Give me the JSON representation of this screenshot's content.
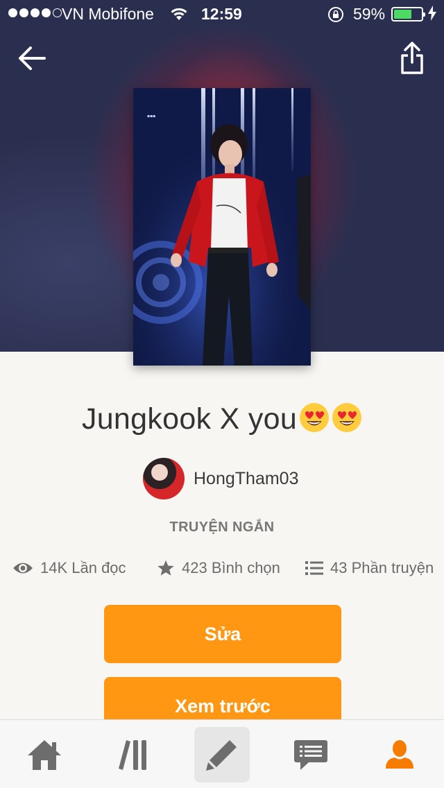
{
  "status_bar": {
    "carrier": "VN Mobifone",
    "time": "12:59",
    "battery_percent": "59%",
    "battery_level": 0.59,
    "signal_bars": 4
  },
  "header": {
    "back_icon": "arrow-left-icon",
    "share_icon": "share-icon"
  },
  "story": {
    "title": "Jungkook X you",
    "title_emoji": "heart-eyes-emoji",
    "author": "HongTham03",
    "genre": "TRUYỆN NGẮN",
    "stats": {
      "reads": "14K Lần đọc",
      "votes": "423 Bình chọn",
      "parts": "43 Phần truyện"
    }
  },
  "actions": {
    "edit_label": "Sửa",
    "preview_label": "Xem trước"
  },
  "tabbar": {
    "items": [
      {
        "icon": "home-icon"
      },
      {
        "icon": "library-icon"
      },
      {
        "icon": "pencil-icon",
        "active": true
      },
      {
        "icon": "messages-icon"
      },
      {
        "icon": "profile-icon"
      }
    ]
  },
  "colors": {
    "accent": "#ff9712",
    "battery": "#4cd964",
    "profile_tab": "#f57c00",
    "background": "#f7f6f2"
  }
}
